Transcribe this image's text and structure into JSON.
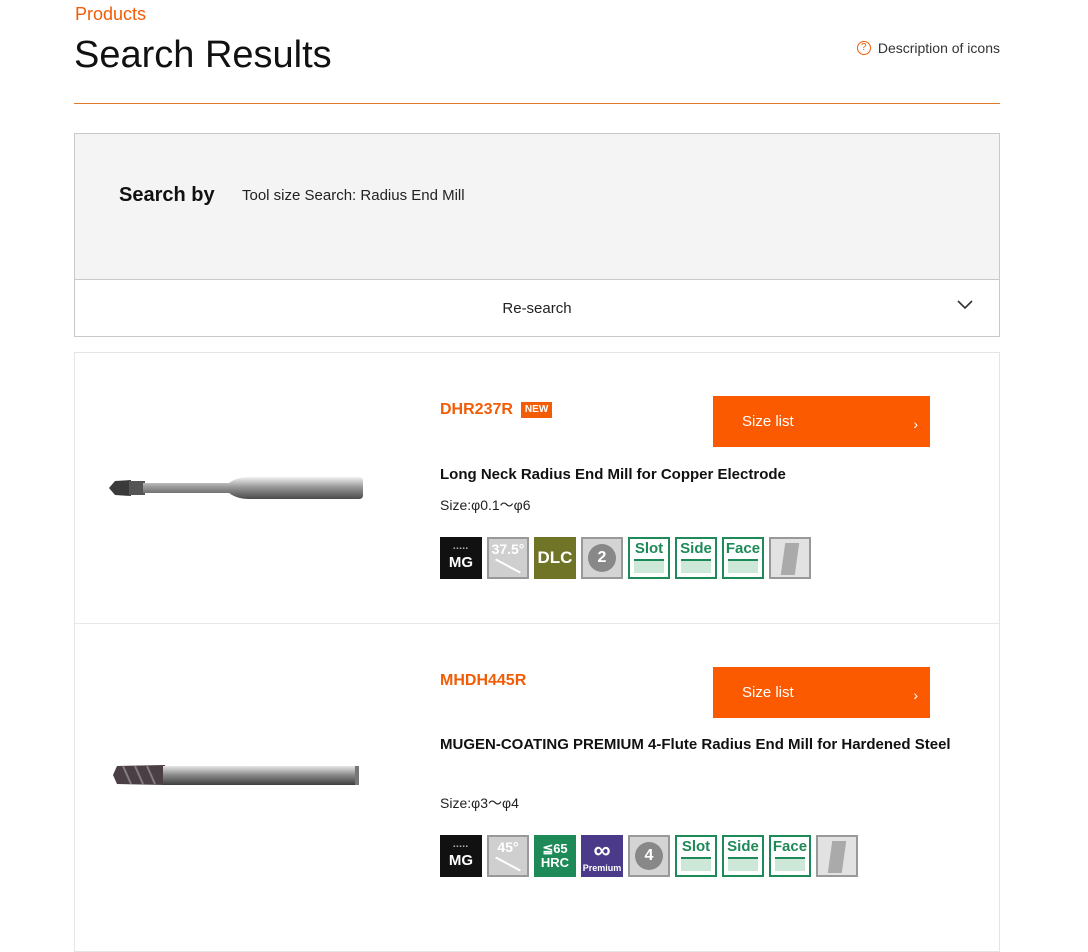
{
  "header": {
    "breadcrumb": "Products",
    "title": "Search Results",
    "icons_help": "Description of icons",
    "help_icon": "question-circle-icon"
  },
  "search": {
    "label": "Search by",
    "value": "Tool size Search: Radius End Mill",
    "research_label": "Re-search",
    "toggle_icon": "chevron-down-icon"
  },
  "products": [
    {
      "code": "DHR237R",
      "badge": "NEW",
      "size_button": "Size list",
      "name": "Long Neck Radius End Mill for Copper Electrode",
      "size": "Size:φ0.1～φ6",
      "feature_icons": {
        "mg": "MG",
        "angle": "37.5°",
        "dlc": "DLC",
        "flutes": "2",
        "slot": "Slot",
        "side": "Side",
        "face": "Face"
      }
    },
    {
      "code": "MHDH445R",
      "size_button": "Size list",
      "name": "MUGEN-COATING PREMIUM 4-Flute Radius End Mill for Hardened Steel",
      "size": "Size:φ3～φ4",
      "feature_icons": {
        "mg": "MG",
        "angle": "45°",
        "hrc_top": "≦65",
        "hrc_bottom": "HRC",
        "premium_symbol": "∞",
        "premium": "Premium",
        "flutes": "4",
        "slot": "Slot",
        "side": "Side",
        "face": "Face"
      }
    }
  ],
  "colors": {
    "accent": "#f25c05",
    "button": "#fc5a00",
    "feature_green": "#1d8a57",
    "dlc": "#6f7426",
    "premium": "#4b3a8a"
  }
}
